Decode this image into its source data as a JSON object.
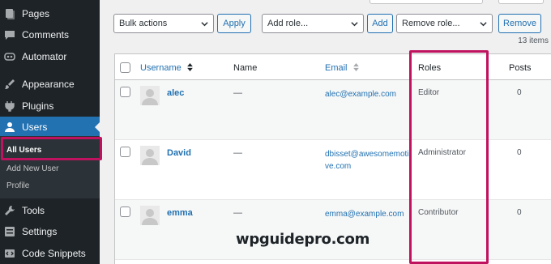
{
  "sidebar": {
    "items": [
      {
        "label": "Pages",
        "icon": "pages-icon"
      },
      {
        "label": "Comments",
        "icon": "comments-icon"
      },
      {
        "label": "Automator",
        "icon": "automator-icon"
      },
      {
        "label": "Appearance",
        "icon": "appearance-icon"
      },
      {
        "label": "Plugins",
        "icon": "plugins-icon"
      },
      {
        "label": "Users",
        "icon": "users-icon",
        "current": true
      },
      {
        "label": "Tools",
        "icon": "tools-icon"
      },
      {
        "label": "Settings",
        "icon": "settings-icon"
      },
      {
        "label": "Code Snippets",
        "icon": "code-snippets-icon"
      }
    ],
    "submenu": [
      {
        "label": "All Users",
        "current": true
      },
      {
        "label": "Add New User"
      },
      {
        "label": "Profile"
      }
    ]
  },
  "toolbar": {
    "bulk_actions": "Bulk actions",
    "apply_label": "Apply",
    "add_role": "Add role...",
    "add_label": "Add",
    "remove_role": "Remove role...",
    "remove_label": "Remove",
    "items_count": "13 items"
  },
  "table": {
    "columns": {
      "username": "Username",
      "name": "Name",
      "email": "Email",
      "roles": "Roles",
      "posts": "Posts"
    },
    "rows": [
      {
        "username": "alec",
        "name": "—",
        "email": "alec@example.com",
        "role": "Editor",
        "posts": "0"
      },
      {
        "username": "David",
        "name": "—",
        "email": "dbisset@awesomemotive.com",
        "role": "Administrator",
        "posts": "0"
      },
      {
        "username": "emma",
        "name": "—",
        "email": "emma@example.com",
        "role": "Contributor",
        "posts": "0"
      }
    ]
  },
  "watermark": "wpguidepro.com",
  "colors": {
    "sidebar_bg": "#1d2327",
    "accent": "#2271b1",
    "highlight": "#c0135f"
  }
}
